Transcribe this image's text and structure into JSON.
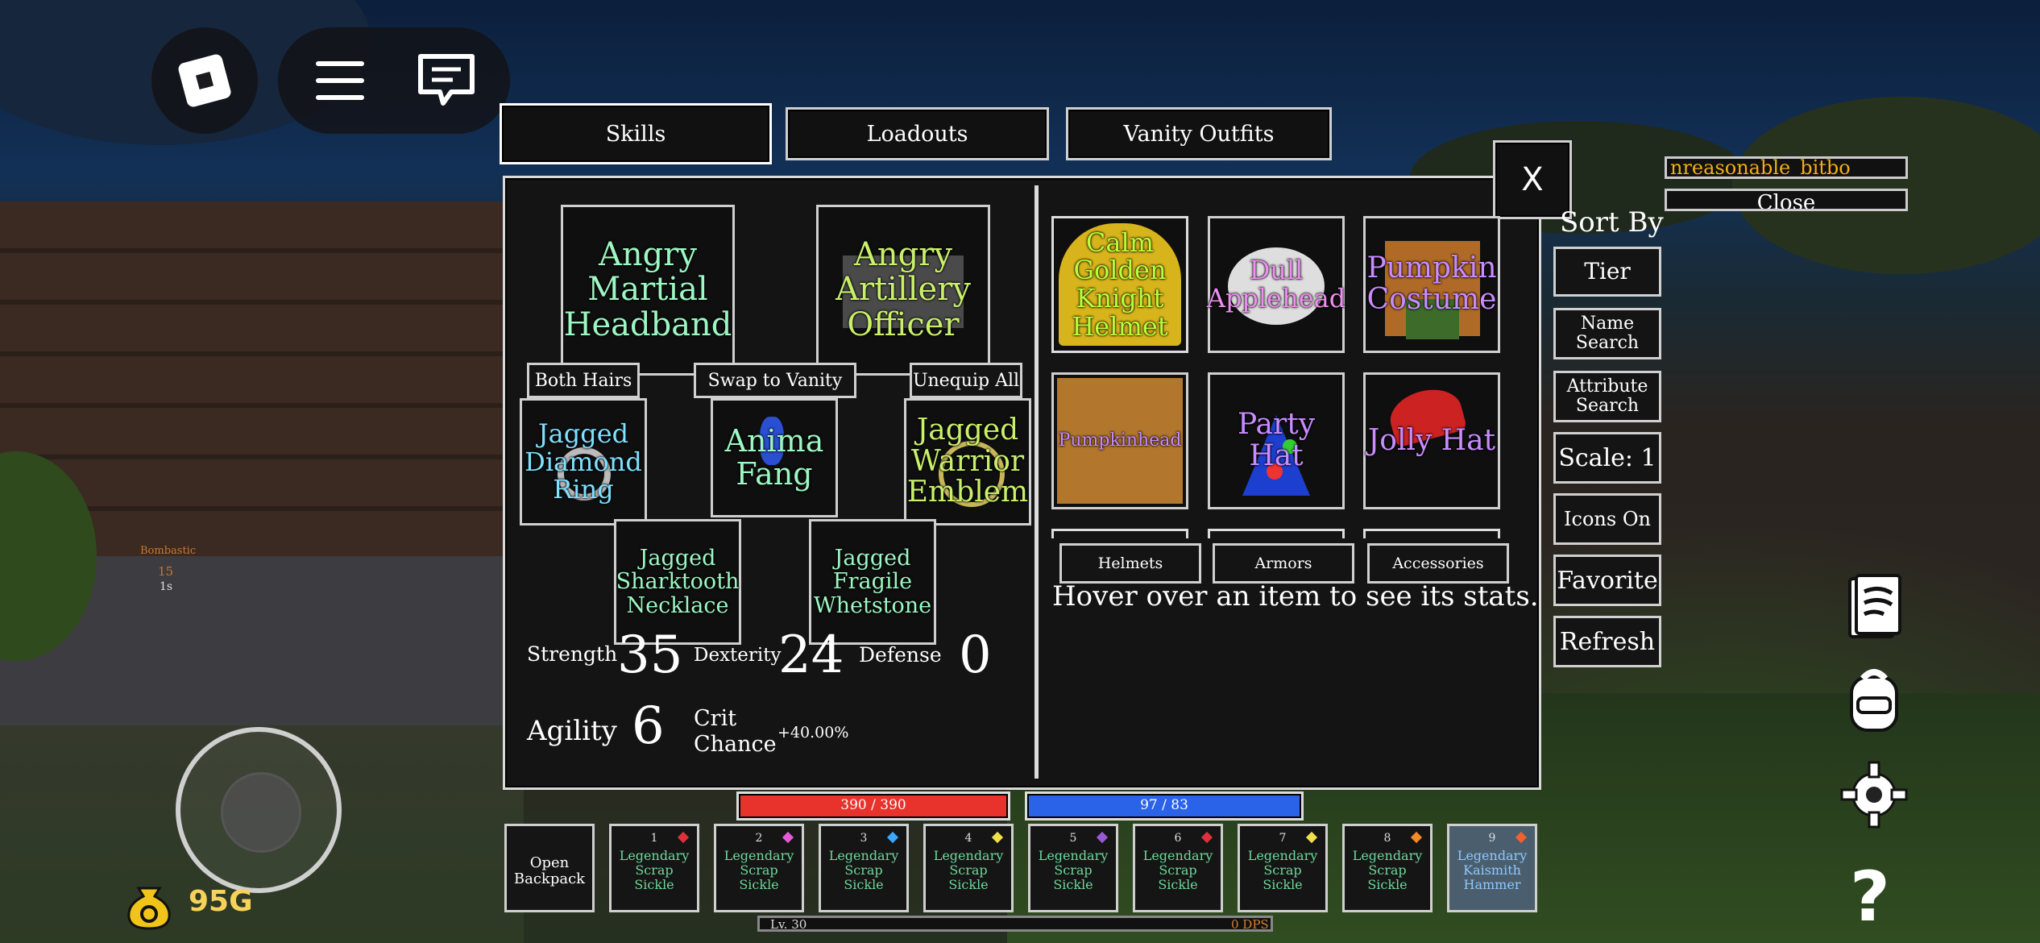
{
  "tabs": [
    "Skills",
    "Loadouts",
    "Vanity Outfits"
  ],
  "close_label": "X",
  "equipped": {
    "head": "Angry Martial Headband",
    "officer": "Angry Artillery Officer",
    "ring": "Jagged Diamond Ring",
    "fang": "Anima Fang",
    "emblem": "Jagged Warrior Emblem",
    "necklace": "Jagged Sharktooth Necklace",
    "whetstone": "Jagged Fragile Whetstone"
  },
  "actions": {
    "both_hairs": "Both Hairs",
    "swap_vanity": "Swap to Vanity",
    "unequip_all": "Unequip All"
  },
  "stats": {
    "strength_label": "Strength",
    "strength": "35",
    "dexterity_label": "Dexterity",
    "dexterity": "24",
    "defense_label": "Defense",
    "defense": "0",
    "agility_label": "Agility",
    "agility": "6",
    "crit_label_1": "Crit",
    "crit_label_2": "Chance",
    "crit": "+40.00%"
  },
  "inventory": [
    "Calm Golden Knight Helmet",
    "Dull Applehead",
    "Pumpkin Costume",
    "Pumpkinhead",
    "Party Hat",
    "Jolly Hat"
  ],
  "categories": [
    "Helmets",
    "Armors",
    "Accessories"
  ],
  "hover_hint": "Hover over an item to see its stats.",
  "search_box": "nreasonable_bitbo",
  "search_close": "Close",
  "sort": {
    "title": "Sort By",
    "tier": "Tier",
    "name_1": "Name",
    "name_2": "Search",
    "attr_1": "Attribute",
    "attr_2": "Search",
    "scale": "Scale: 1",
    "icons": "Icons On",
    "favorite": "Favorite",
    "refresh": "Refresh"
  },
  "bars": {
    "health": "390 / 390",
    "health_fraction": 1.0,
    "mana": "97 / 83",
    "mana_fraction": 1.0
  },
  "backpack_1": "Open",
  "backpack_2": "Backpack",
  "hotbar": [
    {
      "num": "1",
      "l1": "Legendary",
      "l2": "Scrap",
      "l3": "Sickle",
      "gem": "#e0303a"
    },
    {
      "num": "2",
      "l1": "Legendary",
      "l2": "Scrap",
      "l3": "Sickle",
      "gem": "#e65ad8"
    },
    {
      "num": "3",
      "l1": "Legendary",
      "l2": "Scrap",
      "l3": "Sickle",
      "gem": "#3aa8ff"
    },
    {
      "num": "4",
      "l1": "Legendary",
      "l2": "Scrap",
      "l3": "Sickle",
      "gem": "#f2e04a"
    },
    {
      "num": "5",
      "l1": "Legendary",
      "l2": "Scrap",
      "l3": "Sickle",
      "gem": "#9a5ad8"
    },
    {
      "num": "6",
      "l1": "Legendary",
      "l2": "Scrap",
      "l3": "Sickle",
      "gem": "#e0303a"
    },
    {
      "num": "7",
      "l1": "Legendary",
      "l2": "Scrap",
      "l3": "Sickle",
      "gem": "#f2e04a"
    },
    {
      "num": "8",
      "l1": "Legendary",
      "l2": "Scrap",
      "l3": "Sickle",
      "gem": "#f28a2a"
    },
    {
      "num": "9",
      "l1": "Legendary",
      "l2": "Kaismith",
      "l3": "Hammer",
      "gem": "#f06030"
    }
  ],
  "level": "Lv. 30",
  "dps": "0 DPS",
  "gold": "95G",
  "player": {
    "name": "Bombastic",
    "num": "15",
    "sub": "1s"
  },
  "colors": {
    "health": "#e8322c",
    "mana": "#2a63e8",
    "gold": "#f0c419"
  }
}
